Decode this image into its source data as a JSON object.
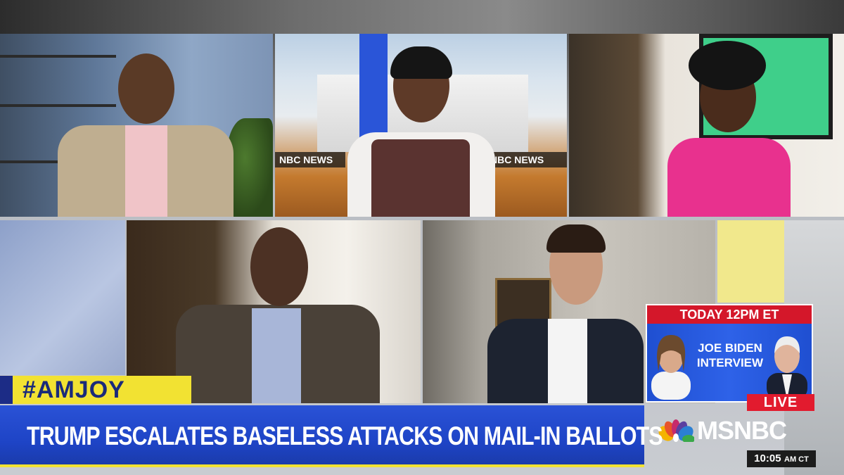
{
  "show": {
    "hashtag": "#AMJOY"
  },
  "headline": {
    "text": "TRUMP ESCALATES BASELESS ATTACKS ON MAIL-IN BALLOTS"
  },
  "broadcast_bug": {
    "text": "NBC NEWS"
  },
  "promo": {
    "time": "TODAY 12PM ET",
    "title": "JOE BIDEN INTERVIEW"
  },
  "live_badge": "LIVE",
  "network": {
    "name": "MSNBC"
  },
  "clock": {
    "time": "10:05",
    "zone": "AM CT"
  },
  "colors": {
    "headline_blue": "#1e44c6",
    "hashtag_yellow": "#f2e232",
    "live_red": "#e21b2e",
    "promo_red": "#d4172a"
  }
}
